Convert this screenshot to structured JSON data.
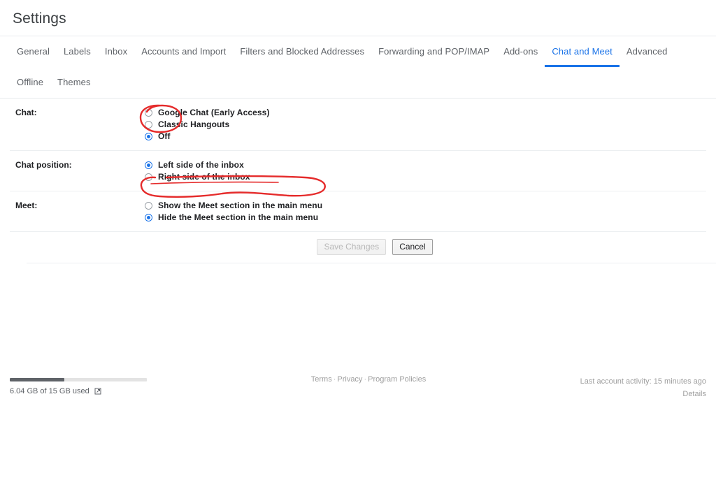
{
  "header": {
    "title": "Settings"
  },
  "tabs": [
    {
      "label": "General",
      "active": false
    },
    {
      "label": "Labels",
      "active": false
    },
    {
      "label": "Inbox",
      "active": false
    },
    {
      "label": "Accounts and Import",
      "active": false
    },
    {
      "label": "Filters and Blocked Addresses",
      "active": false
    },
    {
      "label": "Forwarding and POP/IMAP",
      "active": false
    },
    {
      "label": "Add-ons",
      "active": false
    },
    {
      "label": "Chat and Meet",
      "active": true
    },
    {
      "label": "Advanced",
      "active": false
    },
    {
      "label": "Offline",
      "active": false
    },
    {
      "label": "Themes",
      "active": false
    }
  ],
  "sections": [
    {
      "label": "Chat:",
      "options": [
        {
          "label": "Google Chat (Early Access)",
          "selected": false
        },
        {
          "label": "Classic Hangouts",
          "selected": false
        },
        {
          "label": "Off",
          "selected": true
        }
      ]
    },
    {
      "label": "Chat position:",
      "options": [
        {
          "label": "Left side of the inbox",
          "selected": true
        },
        {
          "label": "Right side of the inbox",
          "selected": false
        }
      ]
    },
    {
      "label": "Meet:",
      "options": [
        {
          "label": "Show the Meet section in the main menu",
          "selected": false
        },
        {
          "label": "Hide the Meet section in the main menu",
          "selected": true
        }
      ]
    }
  ],
  "buttons": {
    "save_label": "Save Changes",
    "cancel_label": "Cancel"
  },
  "footer": {
    "storage_text": "6.04 GB of 15 GB used",
    "storage_percent": 40,
    "links": [
      {
        "label": "Terms"
      },
      {
        "label": "Privacy"
      },
      {
        "label": "Program Policies"
      }
    ],
    "separator": "·",
    "activity_text": "Last account activity: 15 minutes ago",
    "details_label": "Details",
    "external_icon": "external-link-icon"
  },
  "annotations": {
    "color": "#e52b2b",
    "marks": [
      {
        "name": "circle-around-off-option",
        "shape": "ellipse"
      },
      {
        "name": "circle-around-hide-meet-option",
        "shape": "lasso"
      }
    ]
  }
}
